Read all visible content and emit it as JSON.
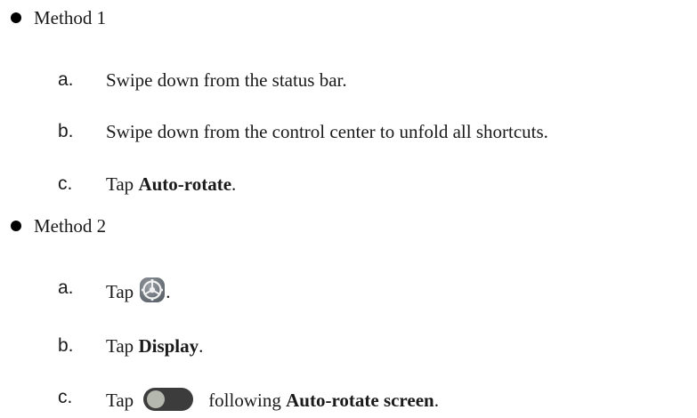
{
  "method1": {
    "label": "Method 1",
    "steps": [
      {
        "letter": "a.",
        "text": "Swipe down from the status bar."
      },
      {
        "letter": "b.",
        "text": "Swipe down from the control center to unfold all shortcuts."
      },
      {
        "letter": "c.",
        "prefix": "Tap ",
        "bold": "Auto-rotate",
        "suffix": "."
      }
    ]
  },
  "method2": {
    "label": "Method 2",
    "steps": [
      {
        "letter": "a.",
        "prefix": "Tap",
        "suffix": ".",
        "icon": "settings-gear-icon"
      },
      {
        "letter": "b.",
        "prefix": "Tap ",
        "bold": "Display",
        "suffix": "."
      },
      {
        "letter": "c.",
        "prefix": "Tap",
        "middle": "following ",
        "bold": "Auto-rotate screen",
        "suffix": ".",
        "icon": "toggle-switch-off-icon"
      }
    ]
  },
  "colors": {
    "text": "#1a1a1a",
    "icon_gray": "#6f747a",
    "toggle_track": "#3c3c3c",
    "toggle_knob": "#b4b8ae"
  }
}
